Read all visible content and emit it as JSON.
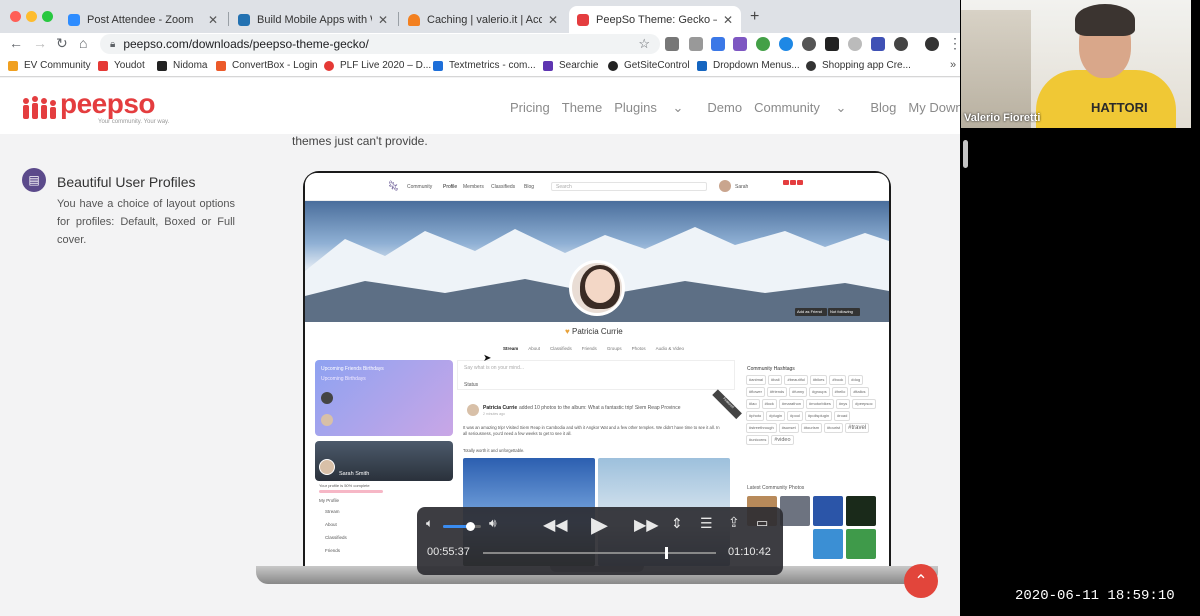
{
  "tabs": [
    {
      "title": "Post Attendee - Zoom",
      "favicon_color": "#2d8cff",
      "active": false
    },
    {
      "title": "Build Mobile Apps with WordP",
      "favicon_color": "#2271b1",
      "active": false
    },
    {
      "title": "Caching | valerio.it | Account |",
      "favicon_color": "#f38020",
      "active": false
    },
    {
      "title": "PeepSo Theme: Gecko – Peep",
      "favicon_color": "#e43d3f",
      "active": true
    }
  ],
  "url": "peepso.com/downloads/peepso-theme-gecko/",
  "bookmarks": [
    "EV Community",
    "Youdot",
    "Nidoma",
    "ConvertBox - Login",
    "PLF Live 2020 – D...",
    "Textmetrics - com...",
    "Searchie",
    "GetSiteControl",
    "Dropdown Menus...",
    "Shopping app Cre..."
  ],
  "site": {
    "logo": "peepso",
    "tagline": "Your community. Your way.",
    "nav": [
      "Pricing",
      "Theme",
      "Plugins",
      "Demo",
      "Community",
      "Blog",
      "My Downloads"
    ]
  },
  "content": {
    "intro_text": "themes just can't provide.",
    "feature_title": "Beautiful User Profiles",
    "feature_desc": "You have a choice of layout options for profiles: Default, Boxed or Full cover."
  },
  "preview": {
    "nav": [
      "Community",
      "Profile",
      "Members",
      "Classifieds",
      "Blog"
    ],
    "search_placeholder": "Search",
    "header_user": "Sarah",
    "profile_name": "Patricia Currie",
    "profile_tabs": [
      "Stream",
      "About",
      "Classifieds",
      "Friends",
      "Groups",
      "Photos",
      "Audio & Video"
    ],
    "cover_buttons": [
      "Add as Friend",
      "Not following"
    ],
    "left_panel_title": "Upcoming Friends Birthdays",
    "left_panel_sub": "Upcoming Birthdays",
    "left_card_name": "Sarah Smith",
    "left_card_progress": "Your profile is 50% complete",
    "left_menu_title": "My Profile",
    "left_menu": [
      "Stream",
      "About",
      "Classifieds",
      "Friends"
    ],
    "composer_placeholder": "Say what is on your mind...",
    "composer_tab": "Status",
    "post_author": "Patricia Currie",
    "post_action": "added 10 photos to the album: What a fantastic trip! Siem Reap Province",
    "post_time": "2 minutes ago",
    "post_body": "It was an amazing trip! Visited Siem Reap in Cambodia and with it Angkor Wat and a few other temples. We didn't have time to see it all. In all seriousness, you'd need a few weeks to get to see it all.",
    "post_body2": "Totally worth it and unforgettable.",
    "post_ribbon": "Featured",
    "hashtags_title": "Community Hashtags",
    "hashtags": [
      "#animal",
      "#bali",
      "#beautiful",
      "#bikes",
      "#book",
      "#dog",
      "#flower",
      "#friends",
      "#funny",
      "#groups",
      "#hello",
      "#italics",
      "#lao",
      "#lock",
      "#marathon",
      "#motorbikes",
      "#nys",
      "#peepsoc",
      "#photo",
      "#plugin",
      "#pool",
      "#pollsplugin",
      "#road",
      "#streethrough",
      "#sunset",
      "#tourism",
      "#tourist",
      "#travel",
      "#unicorns",
      "#video"
    ],
    "photos_title": "Latest Community Photos"
  },
  "video": {
    "elapsed": "00:55:37",
    "remaining": "01:10:42",
    "progress": 0.78,
    "volume": 0.7
  },
  "webcam": {
    "name": "Valerio Fioretti",
    "shirt_text": "HATTORI"
  },
  "recording_timestamp": "2020-06-11  18:59:10"
}
